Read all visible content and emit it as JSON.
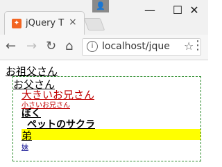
{
  "browser": {
    "tab_title": "jQuery T",
    "tab_close": "×",
    "url": "localhost/jque",
    "win_minimize": "—",
    "win_maximize": "☐",
    "win_close": "✕"
  },
  "page": {
    "grandmother": "お祖父さん",
    "father": "お父さん",
    "big_brother": "大きいお兄さん",
    "small_brother": "小さいお兄さん",
    "me": "ぼく",
    "pet": "ペットのサクラ",
    "brother": "弟",
    "sister": "妹"
  },
  "colors": {
    "highlight": "#ffff00",
    "border": "#2a8b2a",
    "red_text": "#c00000"
  }
}
